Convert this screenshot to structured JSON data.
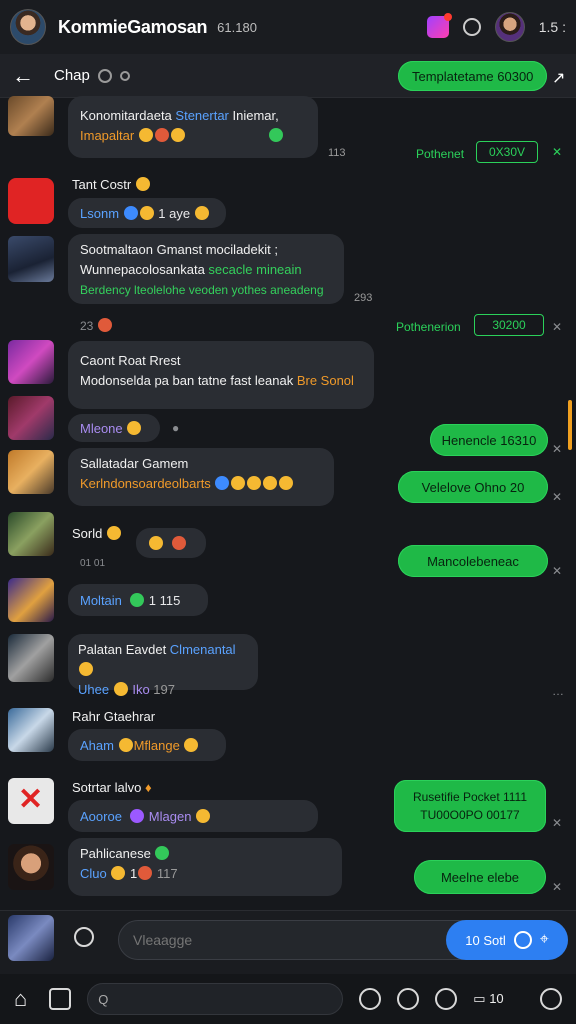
{
  "header": {
    "title": "KommieGamosan",
    "meta": "61.180",
    "clock": "1.5 :"
  },
  "subheader": {
    "chat_name": "Chap",
    "template_label": "Templatetame 60300"
  },
  "outgoing": {
    "top_status": "Pothenet",
    "top_status_box": "0X30V",
    "mid_status": "Pothenerion",
    "mid_status_box": "30200",
    "bubble1": "Henencle 16310",
    "bubble2": "Velelove Ohno 20",
    "bubble3": "Mancolebeneac",
    "bubble4_line1": "Rusetifie Pocket 1111",
    "bubble4_line2": "TU00O0PO 00177",
    "bubble5": "Meelne elebe"
  },
  "messages": [
    {
      "line1a": "Konomitardaeta ",
      "line1b": "Stenertar",
      "line1c": " Iniemar,",
      "line2": "Imapaltar",
      "time": "113"
    },
    {
      "sender": "Tant Costr",
      "text_a": "Lsonm",
      "text_b": "1 aye"
    },
    {
      "line1": "Sootmaltaon Gmanst mociladekit ;",
      "line2a": "Wunnepacolosankata ",
      "line2b": "secacle mineain",
      "line3": "Berdency lteolelohe veoden yothes aneadeng",
      "time": "293"
    },
    {
      "time_small": "23"
    },
    {
      "sender": "Caont Roat Rrest",
      "line_a": "Modonselda pa ban tatne fast leanak ",
      "line_b": "Bre Sonol"
    },
    {
      "text": "Mleone"
    },
    {
      "sender": "Sallatadar Gamem",
      "text": "Kerlndonsoardeolbarts"
    },
    {
      "sender": "Sorld",
      "sub": "01  01"
    },
    {
      "text": "Moltain",
      "num": "1 115"
    },
    {
      "sender_a": "Palatan Eavdet ",
      "sender_b": "Clmenantal",
      "text_a": "Uhee",
      "text_b": "Iko",
      "num": "197"
    },
    {
      "sender": "Rahr Gtaehrar",
      "text_a": "Aham",
      "text_b": "Mflange"
    },
    {
      "sender": "Sotrtar lalvo",
      "text_a": "Aooroe",
      "text_b": "Mlagen"
    },
    {
      "sender": "Pahlicanese",
      "text_a": "Cluo",
      "text_b": "1",
      "num": "117"
    }
  ],
  "input": {
    "placeholder": "Vleaagge",
    "send_label": "10 Sotl"
  },
  "nav": {
    "search_text": "Q",
    "badge": "10"
  }
}
